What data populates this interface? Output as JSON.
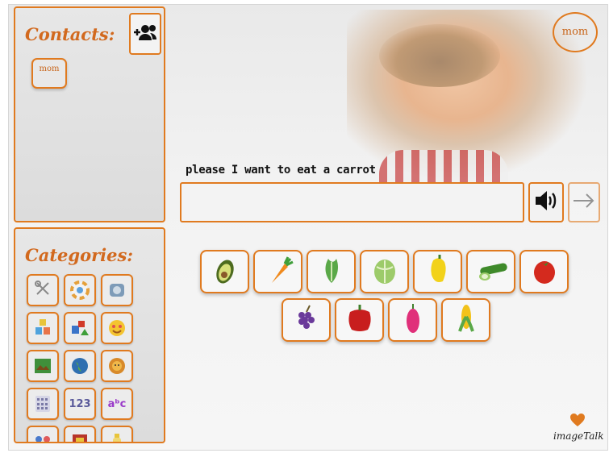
{
  "contacts": {
    "title": "Contacts:",
    "add_icon": "add-contact-icon",
    "items": [
      {
        "label": "mom"
      }
    ]
  },
  "categories": {
    "title": "Categories:",
    "items": [
      {
        "icon": "utensils-icon",
        "color": "#9e9e9e"
      },
      {
        "icon": "color-wheel-icon",
        "color": "#e5a03a"
      },
      {
        "icon": "appliance-icon",
        "color": "#6d8ba8"
      },
      {
        "icon": "toy-blocks-icon",
        "color": "#e8c43a"
      },
      {
        "icon": "shapes-icon",
        "color": "#3a74c9"
      },
      {
        "icon": "smiley-face-icon",
        "color": "#f4c430"
      },
      {
        "icon": "nature-picture-icon",
        "color": "#3f8f3a"
      },
      {
        "icon": "globe-icon",
        "color": "#2f6fb0"
      },
      {
        "icon": "lion-icon",
        "color": "#d88a2a"
      },
      {
        "icon": "calculator-icon",
        "color": "#7a7aa6"
      },
      {
        "icon": "numbers-icon",
        "color": "#5a5a9a",
        "text": "123"
      },
      {
        "icon": "letters-icon",
        "color": "#9a3ac9",
        "text": "aᵇc"
      },
      {
        "icon": "people-icon",
        "color": "#4a7acc"
      },
      {
        "icon": "book-icon",
        "color": "#b8352a"
      },
      {
        "icon": "bottle-icon",
        "color": "#e8c43a"
      }
    ]
  },
  "header": {
    "active_contact": "mom"
  },
  "message": {
    "sentence": "please I want to eat a carrot",
    "input_value": ""
  },
  "controls": {
    "speak_icon": "speaker-icon",
    "next_icon": "arrow-right-icon"
  },
  "foods_row1": [
    {
      "icon": "avocado-icon"
    },
    {
      "icon": "carrot-icon"
    },
    {
      "icon": "lettuce-icon"
    },
    {
      "icon": "cabbage-icon"
    },
    {
      "icon": "yellow-pepper-icon"
    },
    {
      "icon": "cucumber-icon"
    },
    {
      "icon": "tomato-icon"
    }
  ],
  "foods_row2": [
    {
      "icon": "grapes-icon"
    },
    {
      "icon": "red-pepper-icon"
    },
    {
      "icon": "pink-fruit-icon"
    },
    {
      "icon": "corn-icon"
    }
  ],
  "brand": {
    "name": "imageTalk",
    "accent": "#e07a1f"
  }
}
